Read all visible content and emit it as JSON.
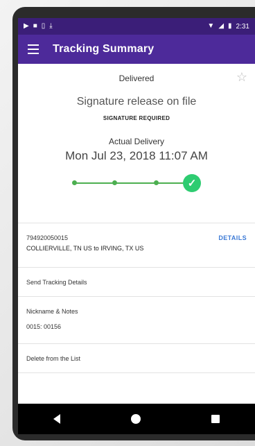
{
  "statusbar": {
    "left_icons": [
      "play-icon",
      "image-icon",
      "sim-icon",
      "download-icon"
    ],
    "right_icons": [
      "wifi-icon",
      "signal-icon",
      "battery-icon"
    ],
    "time": "2:31"
  },
  "appbar": {
    "menu_icon": "menu-icon",
    "title": "Tracking Summary"
  },
  "summary": {
    "status": "Delivered",
    "signature_title": "Signature release on file",
    "signature_required": "SIGNATURE REQUIRED",
    "delivery_label": "Actual Delivery",
    "delivery_date": "Mon Jul 23, 2018 11:07 AM",
    "progress_steps_completed": 4,
    "progress_steps_total": 4
  },
  "tracking": {
    "number": "794920050015",
    "route": "COLLIERVILLE, TN US to IRVING, TX US",
    "details_label": "DETAILS"
  },
  "actions": {
    "send_tracking": "Send Tracking Details",
    "nickname_label": "Nickname & Notes",
    "nickname_value": "0015: 00156",
    "delete_label": "Delete from the List"
  },
  "colors": {
    "appbar": "#4d2a9a",
    "statusbar": "#3b1e78",
    "progress": "#4caf50",
    "link": "#3e7bd6"
  }
}
